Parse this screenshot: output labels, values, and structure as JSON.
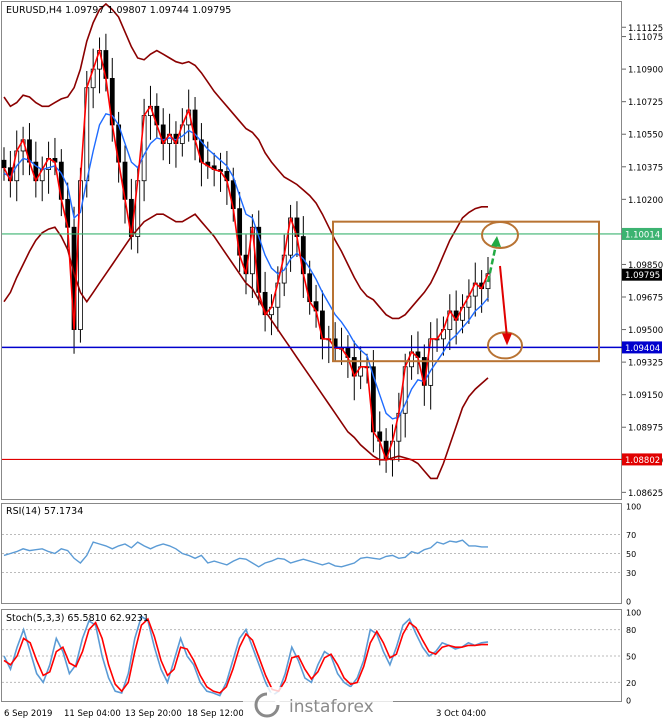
{
  "symbol_header": "EURUSD,H4  1.09797 1.09807 1.09744 1.09795",
  "colors": {
    "candle": "#000000",
    "bollinger": "#8b0000",
    "ma_fast": "#ff0000",
    "ma_slow": "#1e6bff",
    "resistance": "#3cb371",
    "support": "#0000cd",
    "low_level": "#e00000",
    "box": "#b87333",
    "rsi": "#5b9bd5",
    "stoch_main": "#5b9bd5",
    "stoch_signal": "#ff0000",
    "arrow_up": "#22aa44",
    "arrow_down": "#e00000",
    "watermark": "#8a8a8a"
  },
  "chart_data": [
    {
      "type": "line",
      "panel": "price",
      "title": "EURUSD,H4  1.09797 1.09807 1.09744 1.09795",
      "ylim": [
        1.086,
        1.1125
      ],
      "y_ticks": [
        "1.11125",
        "1.11075",
        "1.10900",
        "1.10725",
        "1.10550",
        "1.10375",
        "1.10200",
        "1.09850",
        "1.09675",
        "1.09500",
        "1.09325",
        "1.09150",
        "1.08975",
        "1.08800",
        "1.08625"
      ],
      "x_ticks": [
        "6 Sep 2019",
        "11 Sep 04:00",
        "13 Sep 20:00",
        "18 Sep 12:00",
        "3 Oct 04:00"
      ],
      "series": [
        {
          "values": [
            1.1037,
            1.103,
            1.1046,
            1.1052,
            1.104,
            1.103,
            1.1036,
            1.1042,
            1.104,
            1.102,
            1.1005,
            1.095,
            1.103,
            1.108,
            1.109,
            1.11,
            1.1085,
            1.106,
            1.104,
            1.102,
            1.1,
            1.103,
            1.1065,
            1.107,
            1.106,
            1.105,
            1.1055,
            1.105,
            1.106,
            1.1068,
            1.1052,
            1.104,
            1.1038,
            1.1036,
            1.1035,
            1.103,
            1.1015,
            1.099,
            1.098,
            1.1005,
            1.097,
            1.0958,
            1.0962,
            1.0975,
            1.099,
            1.101,
            1.1,
            1.098,
            1.0965,
            1.096,
            1.0945,
            1.0945,
            1.094,
            1.094,
            1.0935,
            1.0925,
            1.093,
            1.093,
            1.0895,
            1.089,
            1.088,
            1.089,
            1.0905,
            1.093,
            1.0938,
            1.0935,
            1.092,
            1.0945,
            1.0945,
            1.095,
            1.096,
            1.0955,
            1.0962,
            1.0968,
            1.0975,
            1.0972,
            1.098
          ]
        },
        {
          "values": [
            1.1034,
            1.1032,
            1.1038,
            1.1042,
            1.1041,
            1.1038,
            1.1036,
            1.1037,
            1.1038,
            1.1034,
            1.1027,
            1.101,
            1.1013,
            1.103,
            1.1046,
            1.106,
            1.1066,
            1.1065,
            1.106,
            1.105,
            1.104,
            1.1037,
            1.1044,
            1.105,
            1.1053,
            1.1052,
            1.1053,
            1.1052,
            1.1054,
            1.1057,
            1.1055,
            1.1051,
            1.1047,
            1.1044,
            1.1041,
            1.1038,
            1.1032,
            1.1022,
            1.1012,
            1.101,
            1.1,
            1.099,
            1.0983,
            1.098,
            1.0982,
            1.0988,
            1.0991,
            1.0988,
            1.0983,
            1.0977,
            1.097,
            1.0964,
            1.0958,
            1.0954,
            1.0949,
            1.0943,
            1.0939,
            1.0936,
            1.0925,
            1.0915,
            1.0905,
            1.0902,
            1.0903,
            1.091,
            1.0918,
            1.0923,
            1.0922,
            1.0928,
            1.0933,
            1.0938,
            1.0944,
            1.0947,
            1.0951,
            1.0955,
            1.096,
            1.0963,
            1.0967
          ]
        },
        {
          "values": [
            1.1075,
            1.107,
            1.1072,
            1.1076,
            1.1075,
            1.1072,
            1.107,
            1.107,
            1.1072,
            1.1074,
            1.1075,
            1.108,
            1.109,
            1.1105,
            1.1115,
            1.1122,
            1.1125,
            1.1122,
            1.1118,
            1.111,
            1.1102,
            1.1096,
            1.1095,
            1.1098,
            1.11,
            1.1098,
            1.1096,
            1.1094,
            1.1093,
            1.1094,
            1.1092,
            1.1088,
            1.1083,
            1.1078,
            1.1074,
            1.107,
            1.1066,
            1.1062,
            1.1058,
            1.1056,
            1.1052,
            1.1045,
            1.104,
            1.1036,
            1.1032,
            1.103,
            1.1028,
            1.1025,
            1.1022,
            1.1018,
            1.1012,
            1.1005,
            1.0998,
            1.0992,
            1.0985,
            1.0978,
            1.0972,
            1.0968,
            1.0966,
            1.0962,
            1.0958,
            1.0956,
            1.0956,
            1.0958,
            1.0962,
            1.0966,
            1.097,
            1.0975,
            1.0982,
            1.099,
            1.0998,
            1.1004,
            1.101,
            1.1013,
            1.1015,
            1.1016,
            1.1016
          ]
        },
        {
          "values": [
            1.0965,
            1.097,
            1.0978,
            1.0985,
            1.0992,
            1.0998,
            1.1002,
            1.1004,
            1.1005,
            1.1,
            1.0993,
            1.098,
            1.097,
            1.0965,
            1.097,
            1.0975,
            1.098,
            1.0985,
            1.099,
            1.0995,
            1.1,
            1.1004,
            1.1008,
            1.101,
            1.1012,
            1.1012,
            1.101,
            1.1008,
            1.1008,
            1.101,
            1.1012,
            1.1008,
            1.1004,
            1.1,
            1.0995,
            1.099,
            1.0985,
            1.098,
            1.0975,
            1.0972,
            1.0966,
            1.096,
            1.0955,
            1.095,
            1.0945,
            1.094,
            1.0935,
            1.093,
            1.0925,
            1.092,
            1.0915,
            1.091,
            1.0905,
            1.09,
            1.0895,
            1.0892,
            1.0888,
            1.0885,
            1.0882,
            1.088,
            1.088,
            1.0881,
            1.0882,
            1.0881,
            1.088,
            1.0878,
            1.0874,
            1.087,
            1.087,
            1.0878,
            1.0888,
            1.0898,
            1.0908,
            1.0914,
            1.0918,
            1.0921,
            1.0924
          ]
        }
      ],
      "levels": [
        {
          "label": "1.10014",
          "value": 1.10014
        },
        {
          "label": "1.09404",
          "value": 1.09404
        },
        {
          "label": "1.08802",
          "value": 1.08802
        }
      ],
      "last_price_label": "1.09795",
      "last_price": 1.09795,
      "box": {
        "y_top": 1.1008,
        "y_bottom": 1.0933
      },
      "annotations": [
        "arrow-up to 1.10014 resistance",
        "arrow-down to 1.09404 support"
      ]
    },
    {
      "type": "line",
      "panel": "rsi",
      "title": "RSI(14) 57.1734",
      "ylim": [
        0,
        100
      ],
      "y_ticks": [
        "100",
        "70",
        "50",
        "30",
        "0"
      ],
      "series": [
        {
          "values": [
            48,
            50,
            52,
            55,
            53,
            54,
            55,
            52,
            50,
            55,
            53,
            45,
            40,
            48,
            62,
            60,
            58,
            55,
            58,
            60,
            56,
            62,
            58,
            55,
            58,
            60,
            58,
            55,
            50,
            48,
            45,
            48,
            40,
            42,
            40,
            38,
            42,
            45,
            44,
            40,
            36,
            40,
            42,
            45,
            44,
            40,
            42,
            44,
            42,
            40,
            38,
            40,
            37,
            36,
            38,
            40,
            45,
            46,
            45,
            44,
            47,
            48,
            45,
            46,
            52,
            50,
            54,
            56,
            62,
            60,
            63,
            62,
            64,
            58,
            58,
            57,
            57
          ]
        }
      ]
    },
    {
      "type": "line",
      "panel": "stochastic",
      "title": "Stoch(5,3,3) 65.5810 62.9231",
      "ylim": [
        0,
        100
      ],
      "y_ticks": [
        "100",
        "80",
        "50",
        "20",
        "0"
      ],
      "series": [
        {
          "values": [
            50,
            35,
            60,
            80,
            55,
            30,
            20,
            40,
            70,
            55,
            30,
            40,
            70,
            90,
            85,
            50,
            25,
            10,
            8,
            30,
            70,
            95,
            90,
            60,
            35,
            20,
            45,
            70,
            50,
            40,
            20,
            10,
            8,
            5,
            20,
            45,
            70,
            80,
            60,
            40,
            20,
            5,
            10,
            30,
            60,
            45,
            25,
            20,
            40,
            55,
            50,
            30,
            20,
            15,
            25,
            45,
            80,
            75,
            55,
            40,
            60,
            85,
            92,
            75,
            60,
            50,
            55,
            65,
            62,
            58,
            60,
            65,
            62,
            65,
            66
          ]
        },
        {
          "values": [
            45,
            40,
            50,
            70,
            65,
            45,
            28,
            32,
            55,
            60,
            42,
            38,
            55,
            80,
            88,
            70,
            40,
            18,
            10,
            20,
            55,
            85,
            92,
            72,
            45,
            28,
            35,
            60,
            58,
            45,
            28,
            15,
            10,
            8,
            15,
            35,
            60,
            75,
            68,
            48,
            28,
            12,
            10,
            22,
            48,
            50,
            35,
            24,
            32,
            48,
            52,
            40,
            25,
            18,
            20,
            38,
            65,
            78,
            65,
            48,
            52,
            75,
            88,
            82,
            68,
            55,
            52,
            60,
            62,
            60,
            60,
            62,
            62,
            63,
            63
          ]
        }
      ]
    }
  ],
  "watermark": "instaforex"
}
